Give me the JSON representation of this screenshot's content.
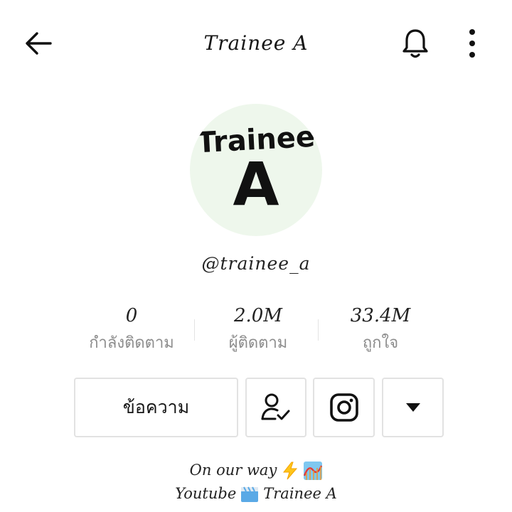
{
  "header": {
    "title": "Trainee A"
  },
  "avatar": {
    "line1": "Trainee",
    "line2": "A",
    "background": "#eef7ec"
  },
  "profile": {
    "username": "@trainee_a"
  },
  "stats": [
    {
      "value": "0",
      "label": "กำลังติดตาม"
    },
    {
      "value": "2.0M",
      "label": "ผู้ติดตาม"
    },
    {
      "value": "33.4M",
      "label": "ถูกใจ"
    }
  ],
  "actions": {
    "message_label": "ข้อความ",
    "follow_icon": "user-check-icon",
    "instagram_icon": "instagram-icon",
    "more_icon": "caret-down-icon"
  },
  "bio": {
    "line1": "On our way",
    "line1_emojis": [
      "lightning-emoji",
      "roller-coaster-emoji"
    ],
    "line2_pre": "Youtube",
    "line2_emoji": "clapper-emoji",
    "line2_post": "Trainee A"
  },
  "icons": {
    "back": "arrow-left-icon",
    "bell": "bell-icon",
    "more": "more-vertical-icon"
  }
}
